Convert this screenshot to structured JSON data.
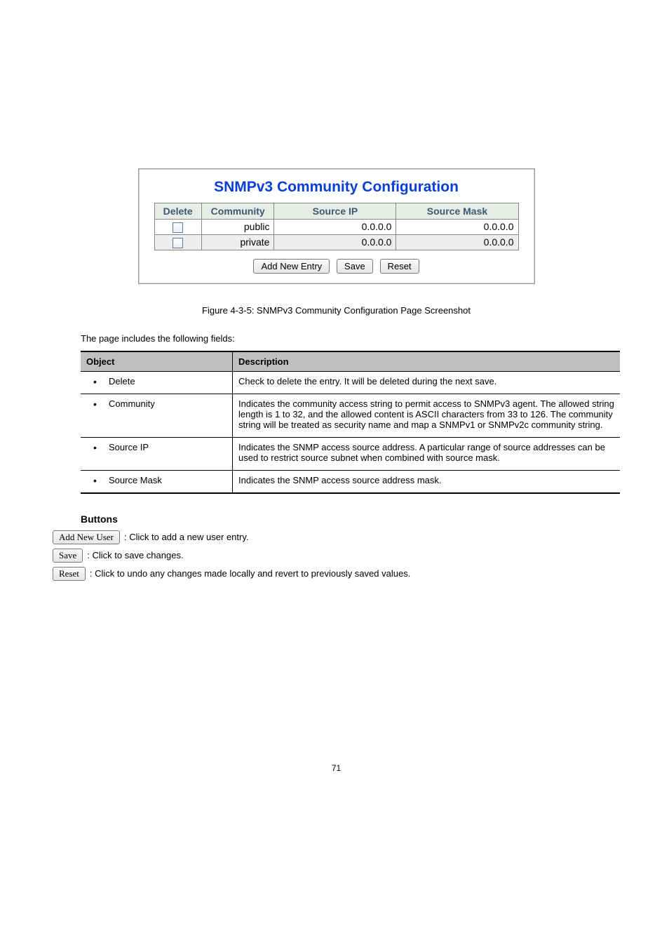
{
  "figure": {
    "title": "SNMPv3 Community Configuration",
    "headers": {
      "delete": "Delete",
      "community": "Community",
      "source_ip": "Source IP",
      "source_mask": "Source Mask"
    },
    "rows": [
      {
        "community": "public",
        "source_ip": "0.0.0.0",
        "source_mask": "0.0.0.0"
      },
      {
        "community": "private",
        "source_ip": "0.0.0.0",
        "source_mask": "0.0.0.0"
      }
    ],
    "buttons": {
      "add": "Add New Entry",
      "save": "Save",
      "reset": "Reset"
    },
    "caption": "Figure 4-3-5: SNMPv3 Community Configuration Page Screenshot"
  },
  "docTable": {
    "intro": "The page includes the following fields:",
    "head": {
      "object": "Object",
      "description": "Description"
    },
    "rows": [
      {
        "object": "Delete",
        "description": "Check to delete the entry. It will be deleted during the next save."
      },
      {
        "object": "Community",
        "description": "Indicates the community access string to permit access to SNMPv3 agent. The allowed string length is 1 to 32, and the allowed content is ASCII characters from 33 to 126. The community string will be treated as security name and map a SNMPv1 or SNMPv2c community string."
      },
      {
        "object": "Source IP",
        "description": "Indicates the SNMP access source address. A particular range of source addresses can be used to restrict source subnet when combined with source mask."
      },
      {
        "object": "Source Mask",
        "description": "Indicates the SNMP access source address mask."
      }
    ]
  },
  "buttonsSection": {
    "heading": "Buttons",
    "items": [
      {
        "label": "Add New User",
        "desc": ": Click to add a new user entry."
      },
      {
        "label": "Save",
        "desc": ": Click to save changes."
      },
      {
        "label": "Reset",
        "desc": ": Click to undo any changes made locally and revert to previously saved values."
      }
    ]
  },
  "footer": "71"
}
